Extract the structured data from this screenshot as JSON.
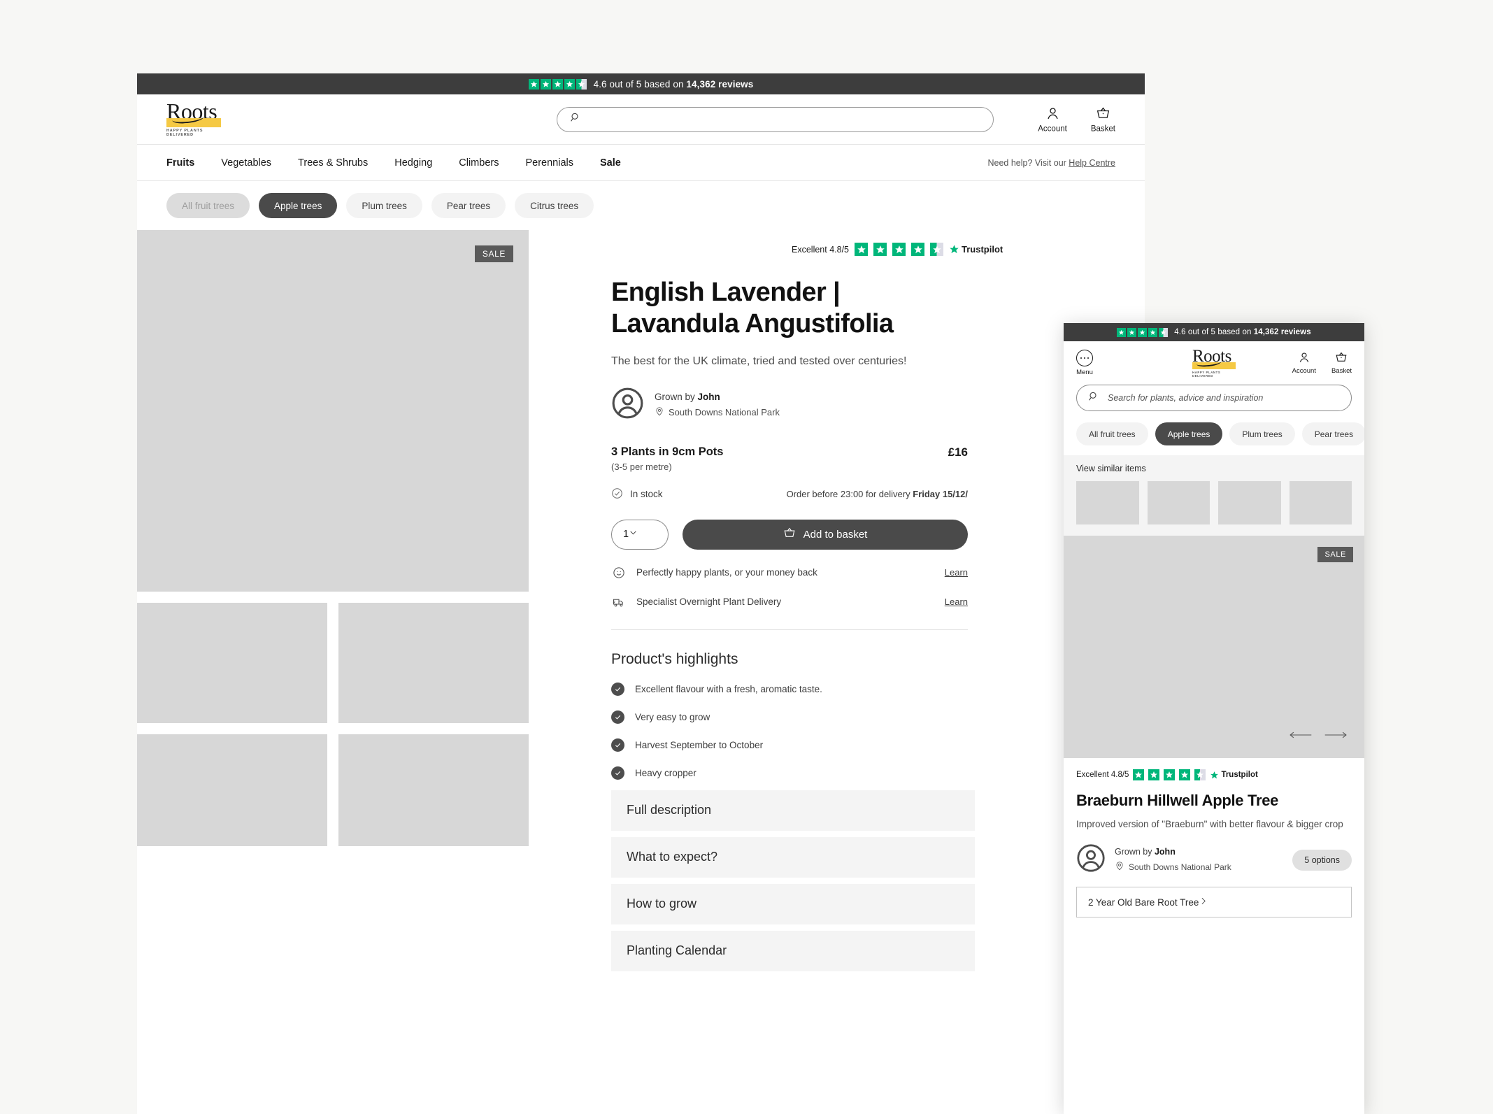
{
  "trustbar": {
    "rating_text": "4.6 out of 5 based on ",
    "reviews": "14,362 reviews",
    "stars": 4.5
  },
  "logo": {
    "word": "Roots",
    "tagline": "HAPPY PLANTS DELIVERED"
  },
  "desktop": {
    "search": {
      "value": "",
      "placeholder": ""
    },
    "account_label": "Account",
    "basket_label": "Basket",
    "nav": [
      {
        "label": "Fruits",
        "bold": true
      },
      {
        "label": "Vegetables",
        "bold": false
      },
      {
        "label": "Trees & Shrubs",
        "bold": false
      },
      {
        "label": "Hedging",
        "bold": false
      },
      {
        "label": "Climbers",
        "bold": false
      },
      {
        "label": "Perennials",
        "bold": false
      },
      {
        "label": "Sale",
        "bold": true
      }
    ],
    "help_prefix": "Need help? Visit our ",
    "help_link": "Help Centre",
    "pills": [
      {
        "label": "All fruit trees",
        "state": "muted"
      },
      {
        "label": "Apple trees",
        "state": "active"
      },
      {
        "label": "Plum trees",
        "state": "default"
      },
      {
        "label": "Pear trees",
        "state": "default"
      },
      {
        "label": "Citrus trees",
        "state": "default"
      }
    ],
    "gallery": {
      "sale_badge": "SALE"
    },
    "product": {
      "trustpilot_label": "Excellent 4.8/5",
      "trustpilot_brand": "Trustpilot",
      "title": "English Lavender | Lavandula Angustifolia",
      "subtitle": "The best for the UK climate, tried and tested over centuries!",
      "grower_prefix": "Grown by ",
      "grower_name": "John",
      "grower_location": "South Downs National Park",
      "variant_title": "3 Plants in 9cm Pots",
      "variant_sub": "(3-5 per metre)",
      "price": "£16",
      "stock": "In stock",
      "delivery_prefix": "Order before 23:00 for delivery ",
      "delivery_date": "Friday 15/12/",
      "quantity": "1",
      "add_to_basket": "Add to basket",
      "benefits": [
        {
          "text": "Perfectly happy plants, or your money back",
          "link": "Learn"
        },
        {
          "text": "Specialist Overnight Plant Delivery",
          "link": "Learn"
        }
      ],
      "highlights_title": "Product's highlights",
      "highlights": [
        "Excellent flavour with a fresh, aromatic taste.",
        "Very easy to grow",
        "Harvest September to October",
        "Heavy cropper"
      ],
      "accordions": [
        "Full description",
        "What to expect?",
        "How to grow",
        "Planting Calendar"
      ]
    }
  },
  "mobile": {
    "menu_label": "Menu",
    "account_label": "Account",
    "basket_label": "Basket",
    "search": {
      "value": "",
      "placeholder": "Search for plants, advice and inspiration"
    },
    "pills": [
      {
        "label": "All fruit trees",
        "state": "default"
      },
      {
        "label": "Apple trees",
        "state": "active"
      },
      {
        "label": "Plum trees",
        "state": "default"
      },
      {
        "label": "Pear trees",
        "state": "default"
      }
    ],
    "similar_title": "View similar items",
    "similar_count": 4,
    "sale_badge": "SALE",
    "product": {
      "trustpilot_label": "Excellent 4.8/5",
      "trustpilot_brand": "Trustpilot",
      "title": "Braeburn Hillwell Apple Tree",
      "subtitle": "Improved version of \"Braeburn\" with better flavour & bigger crop",
      "grower_prefix": "Grown by ",
      "grower_name": "John",
      "grower_location": "South Downs National Park",
      "options_badge": "5 options",
      "variant": "2 Year Old Bare Root Tree"
    }
  }
}
